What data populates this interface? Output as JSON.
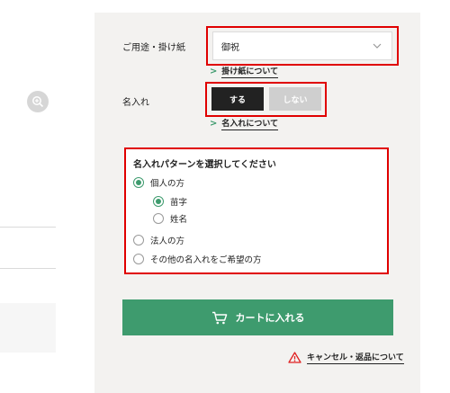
{
  "usage": {
    "label": "ご用途・掛け紙",
    "select_value": "御祝",
    "link": "掛け紙について"
  },
  "engraving": {
    "label": "名入れ",
    "yes": "する",
    "no": "しない",
    "selected": "する",
    "link": "名入れについて"
  },
  "pattern": {
    "title": "名入れパターンを選択してください",
    "options": [
      {
        "label": "個人の方",
        "checked": true
      },
      {
        "label": "苗字",
        "checked": true
      },
      {
        "label": "姓名",
        "checked": false
      },
      {
        "label": "法人の方",
        "checked": false
      },
      {
        "label": "その他の名入れをご希望の方",
        "checked": false
      }
    ]
  },
  "cart_button": "カートに入れる",
  "cancel_link": "キャンセル・返品について",
  "colors": {
    "accent": "#3e9b6e",
    "highlight": "#e00000",
    "panel": "#f3f2f0",
    "warning": "#e02020"
  },
  "icons": [
    "zoom-in-icon",
    "chevron-down-icon",
    "cart-icon",
    "warning-icon"
  ]
}
